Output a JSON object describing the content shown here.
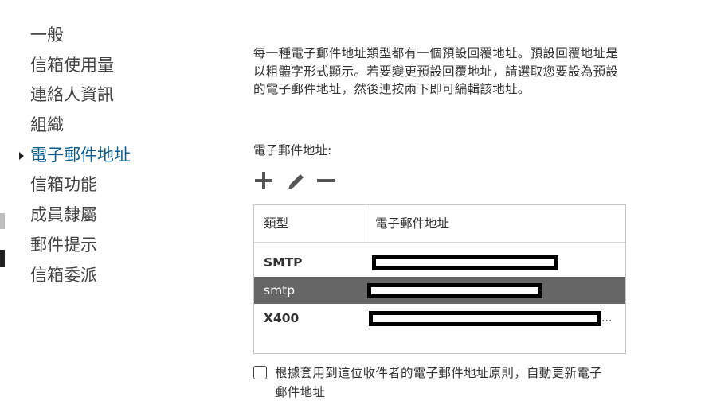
{
  "nav": {
    "items": [
      {
        "label": "一般"
      },
      {
        "label": "信箱使用量"
      },
      {
        "label": "連絡人資訊"
      },
      {
        "label": "組織"
      },
      {
        "label": "電子郵件地址",
        "selected": true
      },
      {
        "label": "信箱功能"
      },
      {
        "label": "成員隸屬"
      },
      {
        "label": "郵件提示"
      },
      {
        "label": "信箱委派"
      }
    ]
  },
  "email_section": {
    "description": "每一種電子郵件地址類型都有一個預設回覆地址。預設回覆地址是以粗體字形式顯示。若要變更預設回覆地址，請選取您要設為預設的電子郵件地址，然後連按兩下即可編輯該地址。",
    "label": "電子郵件地址:",
    "toolbar": {
      "add_icon": "plus-icon",
      "edit_icon": "pencil-icon",
      "remove_icon": "minus-icon"
    },
    "table": {
      "columns": [
        "類型",
        "電子郵件地址"
      ],
      "rows": [
        {
          "type": "SMTP",
          "address": "",
          "selected": false
        },
        {
          "type": "smtp",
          "address": "",
          "selected": true
        },
        {
          "type": "X400",
          "address": "",
          "selected": false,
          "truncated": "..."
        }
      ]
    },
    "auto_update": {
      "checked": false,
      "label": "根據套用到這位收件者的電子郵件地址原則，自動更新電子郵件地址"
    }
  },
  "colors": {
    "accent": "#0f5f8c",
    "selected_row": "#666666"
  }
}
